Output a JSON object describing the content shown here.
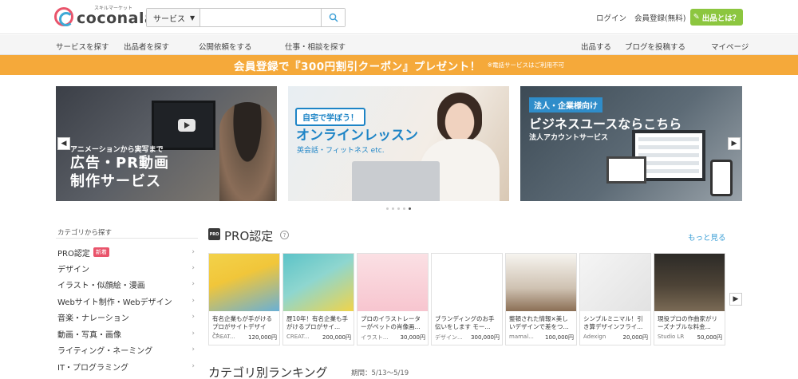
{
  "header": {
    "logo_sub": "スキルマーケット",
    "logo_main": "coconala",
    "search_category": "サービス",
    "search_placeholder": "",
    "login": "ログイン",
    "signup": "会員登録(無料)",
    "sell_button": "出品とは？"
  },
  "nav": {
    "items": [
      "サービスを探す",
      "出品者を探す",
      "公開依頼をする",
      "仕事・相談を探す"
    ],
    "right_items": [
      "出品する",
      "ブログを投稿する",
      "マイページ"
    ]
  },
  "promo": {
    "main": "会員登録で『300円割引クーポン』プレゼント！",
    "note": "※電話サービスはご利用不可"
  },
  "banners": [
    {
      "subtitle": "アニメーションから実写まで",
      "title_line1": "広告・PR動画",
      "title_line2": "制作サービス"
    },
    {
      "tag": "自宅で学ぼう！",
      "title": "オンラインレッスン",
      "subtitle": "英会話・フィットネス etc."
    },
    {
      "tag": "法人・企業様向け",
      "title": "ビジネスユースならこちら",
      "subtitle": "法人アカウントサービス"
    }
  ],
  "sidebar": {
    "title": "カテゴリから探す",
    "items": [
      {
        "label": "PRO認定",
        "badge": "新着"
      },
      {
        "label": "デザイン"
      },
      {
        "label": "イラスト・似顔絵・漫画"
      },
      {
        "label": "Webサイト制作・Webデザイン"
      },
      {
        "label": "音楽・ナレーション"
      },
      {
        "label": "動画・写真・画像"
      },
      {
        "label": "ライティング・ネーミング"
      },
      {
        "label": "IT・プログラミング"
      }
    ]
  },
  "pro": {
    "icon_text": "PRO",
    "title": "PRO認定",
    "more": "もっと見る",
    "cards": [
      {
        "title": "有名企業もが手がけるプロがサイトデザイン...",
        "seller": "CREAT...",
        "price": "120,000円"
      },
      {
        "title": "歴10年！有名企業も手がけるプロがサイ...",
        "seller": "CREAT...",
        "price": "200,000円"
      },
      {
        "title": "プロのイラストレーターがペットの肖像画...",
        "seller": "イラスト...",
        "price": "30,000円"
      },
      {
        "title": "ブランディングのお手伝いをします モー...",
        "seller": "デザイン...",
        "price": "300,000円"
      },
      {
        "title": "整頓された情報×美しいデザインで差をつ...",
        "seller": "mamal...",
        "price": "100,000円"
      },
      {
        "title": "シンプルミニマル！引き算デザインフライ...",
        "seller": "Adexign",
        "price": "20,000円"
      },
      {
        "title": "現役プロの作曲家がリーズナブルな料金...",
        "seller": "Studio LR",
        "price": "50,000円"
      }
    ]
  },
  "ranking": {
    "title": "カテゴリ別ランキング",
    "period": "期間：5/13〜5/19"
  },
  "colors": {
    "accent_orange": "#f5a93a",
    "accent_green": "#8cc63f",
    "link_blue": "#3b9fd6",
    "badge_pink": "#e9546b"
  }
}
